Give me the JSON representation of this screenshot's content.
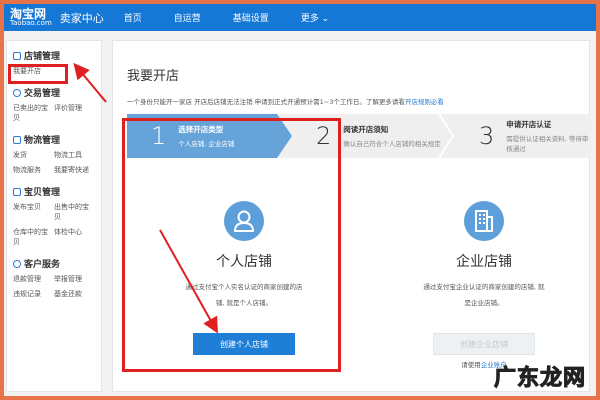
{
  "header": {
    "logo": "淘宝网",
    "logo_sub": "Taobao.com",
    "section": "卖家中心",
    "nav": [
      "首页",
      "自运营",
      "基础设置",
      "更多 ⌄"
    ]
  },
  "sidebar": {
    "groups": [
      {
        "title": "店铺管理",
        "icon": "shop-icon",
        "items": [
          "我要开店"
        ]
      },
      {
        "title": "交易管理",
        "icon": "trade-icon",
        "items": [
          "已卖出的宝贝",
          "评价管理"
        ]
      },
      {
        "title": "物流管理",
        "icon": "logistics-icon",
        "items": [
          "发货",
          "物流工具",
          "物流服务",
          "我要寄快递"
        ]
      },
      {
        "title": "宝贝管理",
        "icon": "bag-icon",
        "items": [
          "发布宝贝",
          "出售中的宝贝",
          "仓库中的宝贝",
          "体检中心"
        ]
      },
      {
        "title": "客户服务",
        "icon": "service-icon",
        "items": [
          "退款管理",
          "举报管理",
          "违规记录",
          "基金还款"
        ]
      }
    ]
  },
  "main": {
    "title": "我要开店",
    "notice": "一个身份只能开一家店 开店后店铺无法注销 申请到正式开通预计需1~3个工作日。了解更多请看",
    "notice_link": "开店规则必看",
    "steps": [
      {
        "num": "1",
        "title": "选择开店类型",
        "sub": "个人店铺, 企业店铺"
      },
      {
        "num": "2",
        "title": "阅读开店须知",
        "sub": "确认自己符合个人店铺的相关规定"
      },
      {
        "num": "3",
        "title": "申请开店认证",
        "sub": "需提供认证相关资料, 等待审核通过"
      }
    ],
    "cards": [
      {
        "title": "个人店铺",
        "desc": "通过支付宝个人实名认证的商家创建的店铺, 就是个人店铺。",
        "button": "创建个人店铺"
      },
      {
        "title": "企业店铺",
        "desc": "通过支付宝企业认证的商家创建的店铺, 就是企业店铺。",
        "button": "创建企业店铺",
        "hint": "请使用",
        "hint_link": "企业账户"
      }
    ]
  },
  "watermark": "广东龙网",
  "colors": {
    "brand": "#1577d6",
    "step_active": "#65a3d8",
    "annotation": "#e02020",
    "border": "#e8734a"
  }
}
